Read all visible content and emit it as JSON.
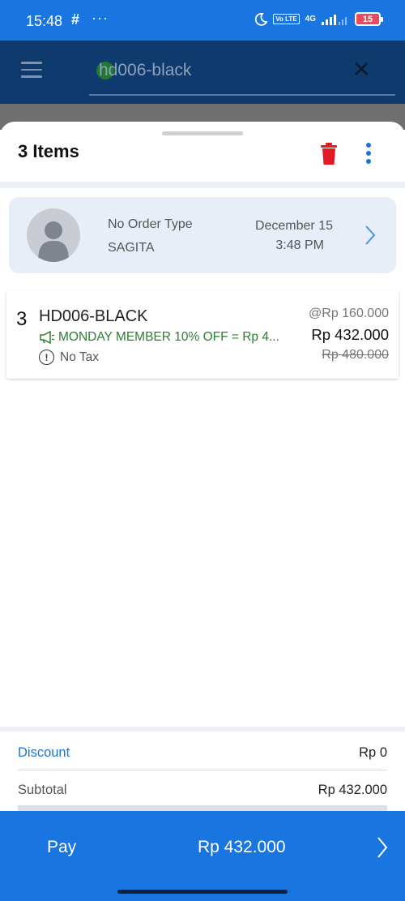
{
  "status_bar": {
    "time": "15:48",
    "dots": "···",
    "network": "4G",
    "volte": "Vo LTE",
    "battery": "15",
    "icons": [
      "slack-icon",
      "moon-icon",
      "signal-icon",
      "battery-icon"
    ]
  },
  "search": {
    "value": "hd006-black"
  },
  "sheet": {
    "title": "3 Items"
  },
  "customer": {
    "order_type": "No Order Type",
    "name": "SAGITA",
    "date": "December 15",
    "time": "3:48 PM"
  },
  "line_item": {
    "qty": "3",
    "name": "HD006-BLACK",
    "promo": "MONDAY MEMBER 10% OFF = Rp 4...",
    "tax": "No Tax",
    "unit_price": "@Rp 160.000",
    "total_price": "Rp 432.000",
    "original_price": "Rp 480.000"
  },
  "summary": {
    "discount_label": "Discount",
    "discount_value": "Rp 0",
    "subtotal_label": "Subtotal",
    "subtotal_value": "Rp 432.000"
  },
  "pay": {
    "label": "Pay",
    "amount": "Rp 432.000"
  },
  "colors": {
    "primary": "#1976e0",
    "delete": "#e01b24",
    "promo": "#2e7d32",
    "link": "#1976d2"
  }
}
